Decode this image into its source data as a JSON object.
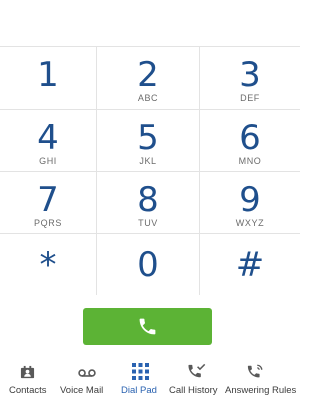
{
  "keypad": {
    "keys": [
      {
        "digit": "1",
        "letters": ""
      },
      {
        "digit": "2",
        "letters": "ABC"
      },
      {
        "digit": "3",
        "letters": "DEF"
      },
      {
        "digit": "4",
        "letters": "GHI"
      },
      {
        "digit": "5",
        "letters": "JKL"
      },
      {
        "digit": "6",
        "letters": "MNO"
      },
      {
        "digit": "7",
        "letters": "PQRS"
      },
      {
        "digit": "8",
        "letters": "TUV"
      },
      {
        "digit": "9",
        "letters": "WXYZ"
      },
      {
        "digit": "*",
        "letters": ""
      },
      {
        "digit": "0",
        "letters": ""
      },
      {
        "digit": "#",
        "letters": ""
      }
    ]
  },
  "call_button": {
    "icon": "phone-icon",
    "color": "#5cb335"
  },
  "tabbar": {
    "active_color": "#2a62b0",
    "tabs": [
      {
        "label": "Contacts",
        "icon": "contacts-icon"
      },
      {
        "label": "Voice Mail",
        "icon": "voicemail-icon"
      },
      {
        "label": "Dial Pad",
        "icon": "dialpad-icon",
        "active": true
      },
      {
        "label": "Call History",
        "icon": "call-history-icon"
      },
      {
        "label": "Answering Rules",
        "icon": "answering-rules-icon"
      }
    ]
  },
  "colors": {
    "digit": "#1f4f8c",
    "letters": "#6b6b6b",
    "divider": "#e3e3e3"
  }
}
